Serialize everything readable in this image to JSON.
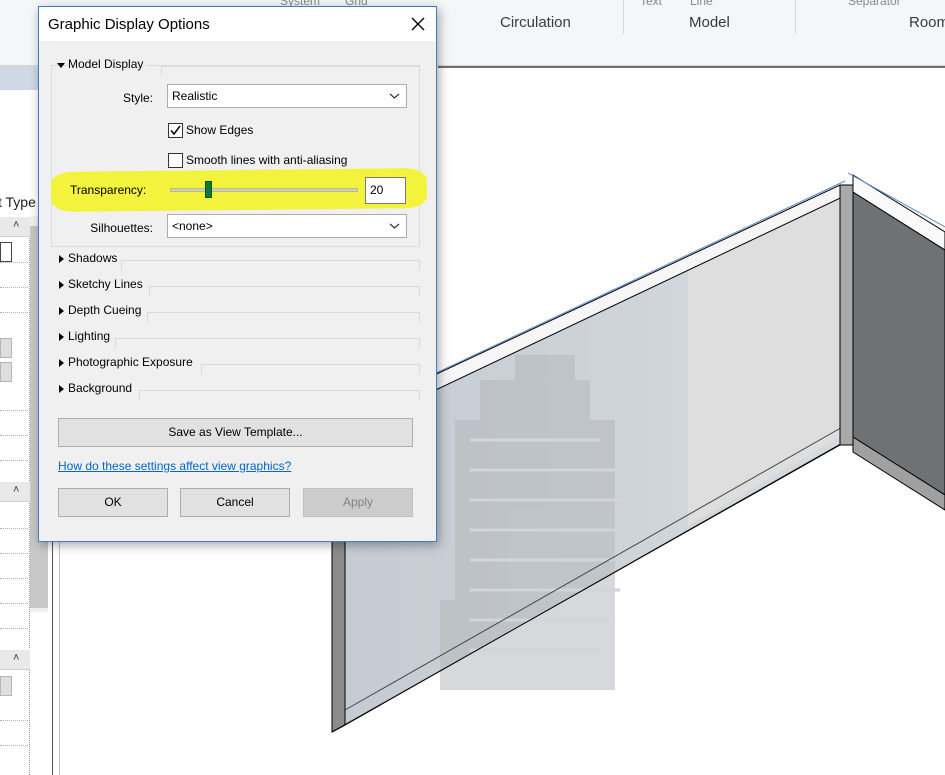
{
  "ribbon": {
    "top_labels": [
      "System",
      "Grid",
      "Text",
      "Line",
      "Separator"
    ],
    "panels": [
      "Circulation",
      "Model",
      "Room"
    ]
  },
  "left_panel": {
    "type_label": "t Type"
  },
  "dialog": {
    "title": "Graphic Display Options",
    "model_display": {
      "header": "Model Display",
      "style_label": "Style:",
      "style_value": "Realistic",
      "show_edges_label": "Show Edges",
      "show_edges_checked": true,
      "smooth_lines_label": "Smooth lines with anti-aliasing",
      "smooth_lines_checked": false,
      "transparency_label": "Transparency:",
      "transparency_value": "20",
      "silhouettes_label": "Silhouettes:",
      "silhouettes_value": "<none>"
    },
    "sections": [
      "Shadows",
      "Sketchy Lines",
      "Depth Cueing",
      "Lighting",
      "Photographic Exposure",
      "Background"
    ],
    "save_template_label": "Save as View Template...",
    "help_link": "How do these settings affect view graphics?",
    "ok_label": "OK",
    "cancel_label": "Cancel",
    "apply_label": "Apply"
  },
  "colors": {
    "highlight": "#f3f33d",
    "slider_thumb": "#0e7a36",
    "link": "#0066cc",
    "dialog_border": "#3d7ebf"
  }
}
